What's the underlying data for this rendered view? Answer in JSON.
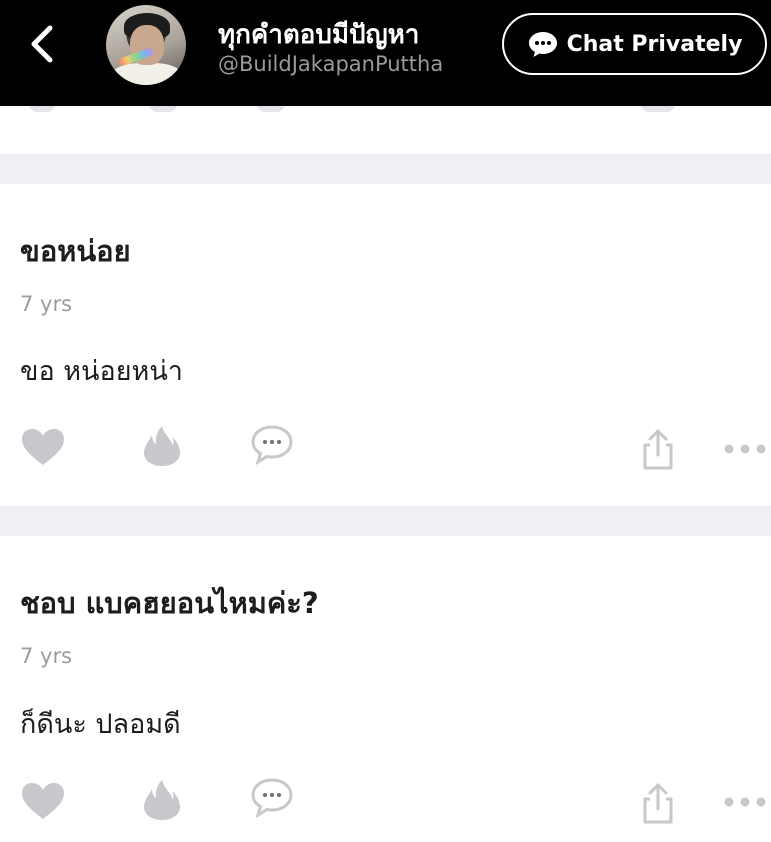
{
  "header": {
    "profile_name": "ทุกคำตอบมีปัญหา",
    "profile_handle": "@BuildJakapanPuttha",
    "chat_button_label": "Chat Privately",
    "icons": [
      "back-arrow-icon",
      "avatar",
      "chat-bubble-icon"
    ]
  },
  "posts": [
    {
      "question": "ขอหน่อย",
      "time": "7 yrs",
      "answer": "ขอ หน่อยหน่า",
      "actions": [
        "heart-icon",
        "fire-icon",
        "comment-icon",
        "share-icon",
        "more-icon"
      ]
    },
    {
      "question": "ชอบ แบคฮยอนไหมค่ะ?",
      "time": "7 yrs",
      "answer": "ก็ดีนะ ปลอมดี",
      "actions": [
        "heart-icon",
        "fire-icon",
        "comment-icon",
        "share-icon",
        "more-icon"
      ]
    }
  ],
  "colors": {
    "header_bg": "#000000",
    "divider_bg": "#eff0f4",
    "icon_gray": "#c7c7cc",
    "text_dark": "#1d1d1f",
    "text_muted": "#9b9b9f"
  }
}
